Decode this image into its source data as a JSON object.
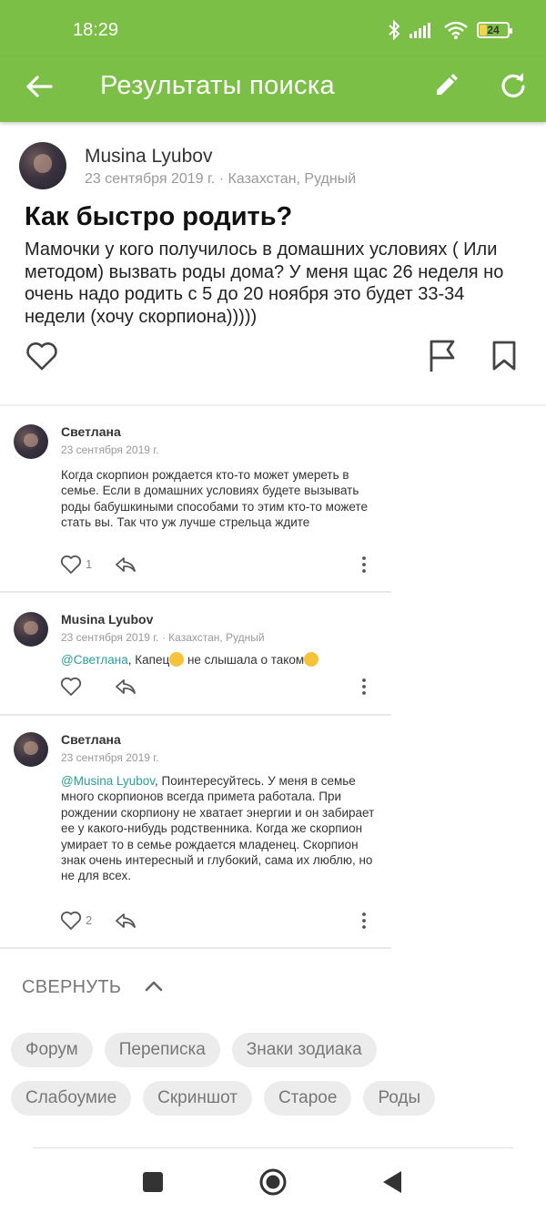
{
  "status": {
    "time": "18:29",
    "battery": "24"
  },
  "appbar": {
    "title": "Результаты поиска"
  },
  "post": {
    "author": "Musina Lyubov",
    "meta": "23 сентября 2019 г. · Казахстан, Рудный",
    "title": "Как быстро родить?",
    "body": "Мамочки у кого получилось в домашних условиях ( Или методом) вызвать роды дома? У меня щас 26 неделя но очень надо родить с 5 до 20 ноября это будет 33-34 недели (хочу скорпиона)))))"
  },
  "comments": [
    {
      "author": "Светлана",
      "meta": "23 сентября 2019 г.",
      "text": "Когда скорпион рождается кто-то может умереть в семье. Если в домашних условиях будете вызывать роды бабушкиными способами то этим кто-то можете стать вы. Так что уж лучше стрельца ждите",
      "likes": "1"
    },
    {
      "author": "Musina Lyubov",
      "meta": "23 сентября 2019 г. · Казахстан, Рудный",
      "mention": "@Светлана",
      "text_a": ", Капец",
      "text_b": " не слышала о таком",
      "likes": ""
    },
    {
      "author": "Светлана",
      "meta": "23 сентября 2019 г.",
      "mention": "@Musina Lyubov",
      "text": ", Поинтересуйтесь. У меня в семье много скорпионов всегда примета работала. При рождении скорпиону не хватает энергии и он забирает ее у какого-нибудь родственника. Когда же скорпион умирает то в семье рождается младенец. Скорпион знак очень интересный и глубокий, сама их люблю, но не для всех.",
      "likes": "2"
    }
  ],
  "collapse_label": "СВЕРНУТЬ",
  "tags": [
    "Форум",
    "Переписка",
    "Знаки зодиака",
    "Слабоумие",
    "Скриншот",
    "Старое",
    "Роды"
  ],
  "colors": {
    "appbar": "#7bbf47",
    "mention": "#2a9d9a"
  },
  "icons": [
    "back-arrow-icon",
    "edit-pencil-icon",
    "refresh-icon",
    "heart-icon",
    "flag-icon",
    "bookmark-icon",
    "reply-icon",
    "more-vert-icon",
    "chevron-up-icon"
  ]
}
